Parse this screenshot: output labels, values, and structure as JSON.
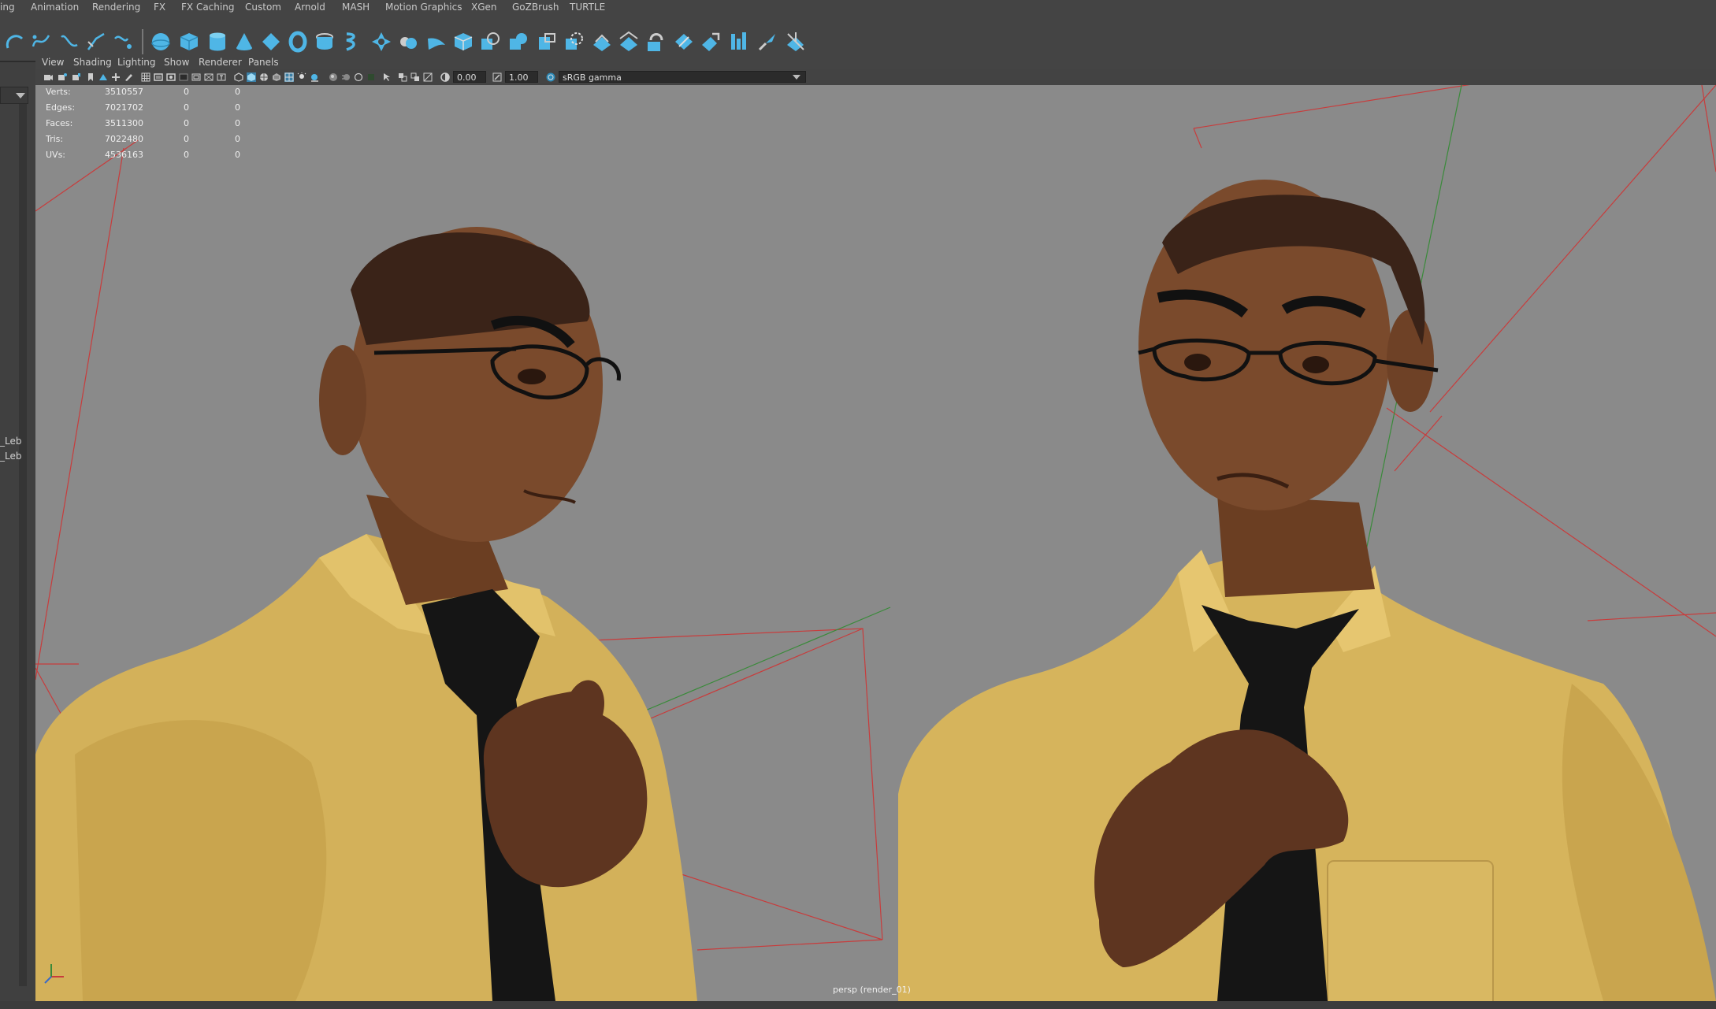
{
  "menubar": {
    "items": [
      "ing",
      "Animation",
      "Rendering",
      "FX",
      "FX Caching",
      "Custom",
      "Arnold",
      "MASH",
      "Motion Graphics",
      "XGen",
      "GoZBrush",
      "TURTLE"
    ]
  },
  "panel_menu": {
    "items": [
      "View",
      "Shading",
      "Lighting",
      "Show",
      "Renderer",
      "Panels"
    ]
  },
  "viewport_toolbar": {
    "field_a": "0.00",
    "field_b": "1.00",
    "color_space": "sRGB gamma"
  },
  "hud": {
    "rows": [
      {
        "label": "Verts:",
        "v1": "3510557",
        "v2": "0",
        "v3": "0"
      },
      {
        "label": "Edges:",
        "v1": "7021702",
        "v2": "0",
        "v3": "0"
      },
      {
        "label": "Faces:",
        "v1": "3511300",
        "v2": "0",
        "v3": "0"
      },
      {
        "label": "Tris:",
        "v1": "7022480",
        "v2": "0",
        "v3": "0"
      },
      {
        "label": "UVs:",
        "v1": "4536163",
        "v2": "0",
        "v3": "0"
      }
    ]
  },
  "outliner": {
    "labels": [
      "_Leb",
      "_Leb"
    ]
  },
  "camera_label": "persp (render_01)",
  "colors": {
    "viewport_bg": "#8a8a8a",
    "shirt": "#d6b45c",
    "skin": "#7a4a2c",
    "tie": "#151515",
    "accent": "#3aa0d0"
  },
  "icons": [
    "lasso-icon",
    "move-curve-icon",
    "cv-curve-icon",
    "ep-curve-icon",
    "bezier-curve-icon",
    "sphere-icon",
    "cube-icon",
    "cylinder-icon",
    "cone-icon",
    "diamond-icon",
    "torus-icon",
    "pipe-icon",
    "helix-icon",
    "gear-icon",
    "soccer-icon",
    "plane-icon",
    "box-icon",
    "combine-icon",
    "separate-icon",
    "extract-icon",
    "smooth-icon",
    "boolean-icon",
    "mirror-icon",
    "bridge-icon",
    "extrude-icon",
    "bevel-icon",
    "fill-hole-icon",
    "multicut-icon",
    "target-weld-icon"
  ]
}
